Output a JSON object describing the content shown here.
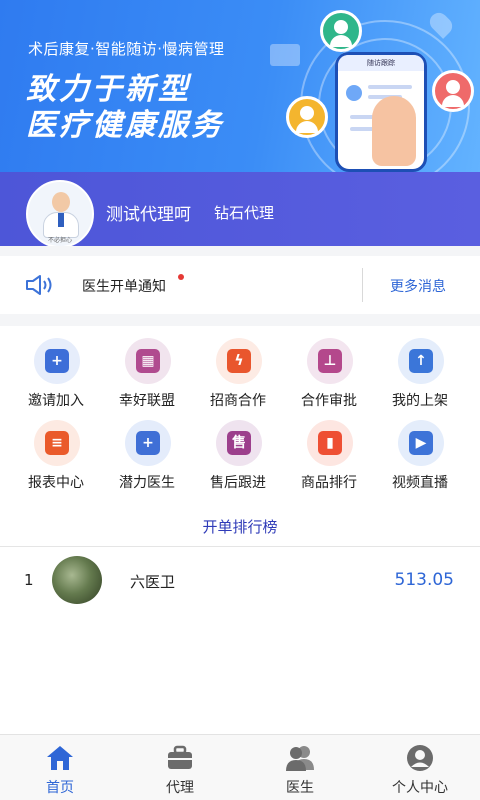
{
  "banner": {
    "subtitle": "术后康复·智能随访·慢病管理",
    "headline_line1": "致力于新型",
    "headline_line2": "医疗健康服务",
    "phone_header": "随访跟踪"
  },
  "user": {
    "name": "测试代理呵",
    "level": "钻石代理",
    "avatar_caption": "不必担心"
  },
  "notice": {
    "text": "医生开单通知",
    "more_label": "更多消息",
    "has_unread": true
  },
  "grid": [
    {
      "label": "邀请加入",
      "icon": "invite-user-icon",
      "bg": "#e6edfb",
      "color": "#3d6ed8",
      "glyph": "+"
    },
    {
      "label": "幸好联盟",
      "icon": "apps-grid-icon",
      "bg": "#f1e4ee",
      "color": "#b04b8f",
      "glyph": "▦"
    },
    {
      "label": "招商合作",
      "icon": "lightning-icon",
      "bg": "#fdebe4",
      "color": "#e9562d",
      "glyph": "ϟ"
    },
    {
      "label": "合作审批",
      "icon": "stamp-icon",
      "bg": "#f3e5ef",
      "color": "#b4488c",
      "glyph": "⊥"
    },
    {
      "label": "我的上架",
      "icon": "box-upload-icon",
      "bg": "#e4edfb",
      "color": "#3b76d9",
      "glyph": "↑"
    },
    {
      "label": "报表中心",
      "icon": "report-icon",
      "bg": "#fdeae2",
      "color": "#ea5a2a",
      "glyph": "≡"
    },
    {
      "label": "潜力医生",
      "icon": "doctor-plus-icon",
      "bg": "#e4ecfb",
      "color": "#3f6fd6",
      "glyph": "+"
    },
    {
      "label": "售后跟进",
      "icon": "after-sales-icon",
      "bg": "#efe3ef",
      "color": "#9c3f8c",
      "glyph": "售"
    },
    {
      "label": "商品排行",
      "icon": "bar-chart-icon",
      "bg": "#fde6e1",
      "color": "#ee4f33",
      "glyph": "▮"
    },
    {
      "label": "视频直播",
      "icon": "video-icon",
      "bg": "#e4edfb",
      "color": "#3d73d8",
      "glyph": "▶"
    }
  ],
  "ranking": {
    "title": "开单排行榜",
    "rows": [
      {
        "rank": "1",
        "name": "六医卫",
        "score": "513.05"
      }
    ]
  },
  "tabbar": [
    {
      "label": "首页",
      "icon": "home-icon",
      "active": true
    },
    {
      "label": "代理",
      "icon": "briefcase-icon",
      "active": false
    },
    {
      "label": "医生",
      "icon": "users-icon",
      "active": false
    },
    {
      "label": "个人中心",
      "icon": "profile-icon",
      "active": false
    }
  ],
  "colors": {
    "accent": "#2e66d6",
    "banner": "#3b8df6",
    "user_card": "#5258dc",
    "unread_dot": "#e53935"
  }
}
